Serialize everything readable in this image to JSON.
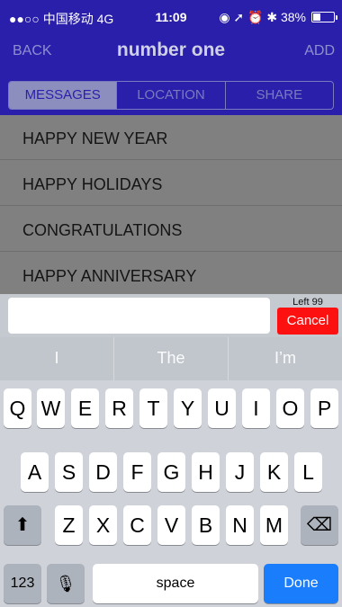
{
  "status_bar": {
    "carrier": "●●○○ 中国移动  4G",
    "time": "11:09",
    "indicators": "◉ ➚ ⏰ ✱ 38%",
    "battery_percent": 38
  },
  "navbar": {
    "back_label": "BACK",
    "title": "number one",
    "add_label": "ADD"
  },
  "tabs": [
    {
      "label": "MESSAGES",
      "active": true
    },
    {
      "label": "LOCATION",
      "active": false
    },
    {
      "label": "SHARE",
      "active": false
    }
  ],
  "messages": [
    "HAPPY NEW YEAR",
    "HAPPY HOLIDAYS",
    "CONGRATULATIONS",
    "HAPPY ANNIVERSARY"
  ],
  "input": {
    "value": "",
    "left_label": "Left 99",
    "cancel_label": "Cancel"
  },
  "keyboard": {
    "predictions": [
      "I",
      "The",
      "I’m"
    ],
    "row1": [
      "Q",
      "W",
      "E",
      "R",
      "T",
      "Y",
      "U",
      "I",
      "O",
      "P"
    ],
    "row2": [
      "A",
      "S",
      "D",
      "F",
      "G",
      "H",
      "J",
      "K",
      "L"
    ],
    "row3": [
      "Z",
      "X",
      "C",
      "V",
      "B",
      "N",
      "M"
    ],
    "numbers_label": "123",
    "space_label": "space",
    "done_label": "Done",
    "shift_glyph": "⬆",
    "mic_glyph": "🎙",
    "delete_glyph": "⌫"
  },
  "colors": {
    "nav_background": "#2a1faa",
    "cancel": "#fc1010",
    "done": "#1a7dfb"
  }
}
